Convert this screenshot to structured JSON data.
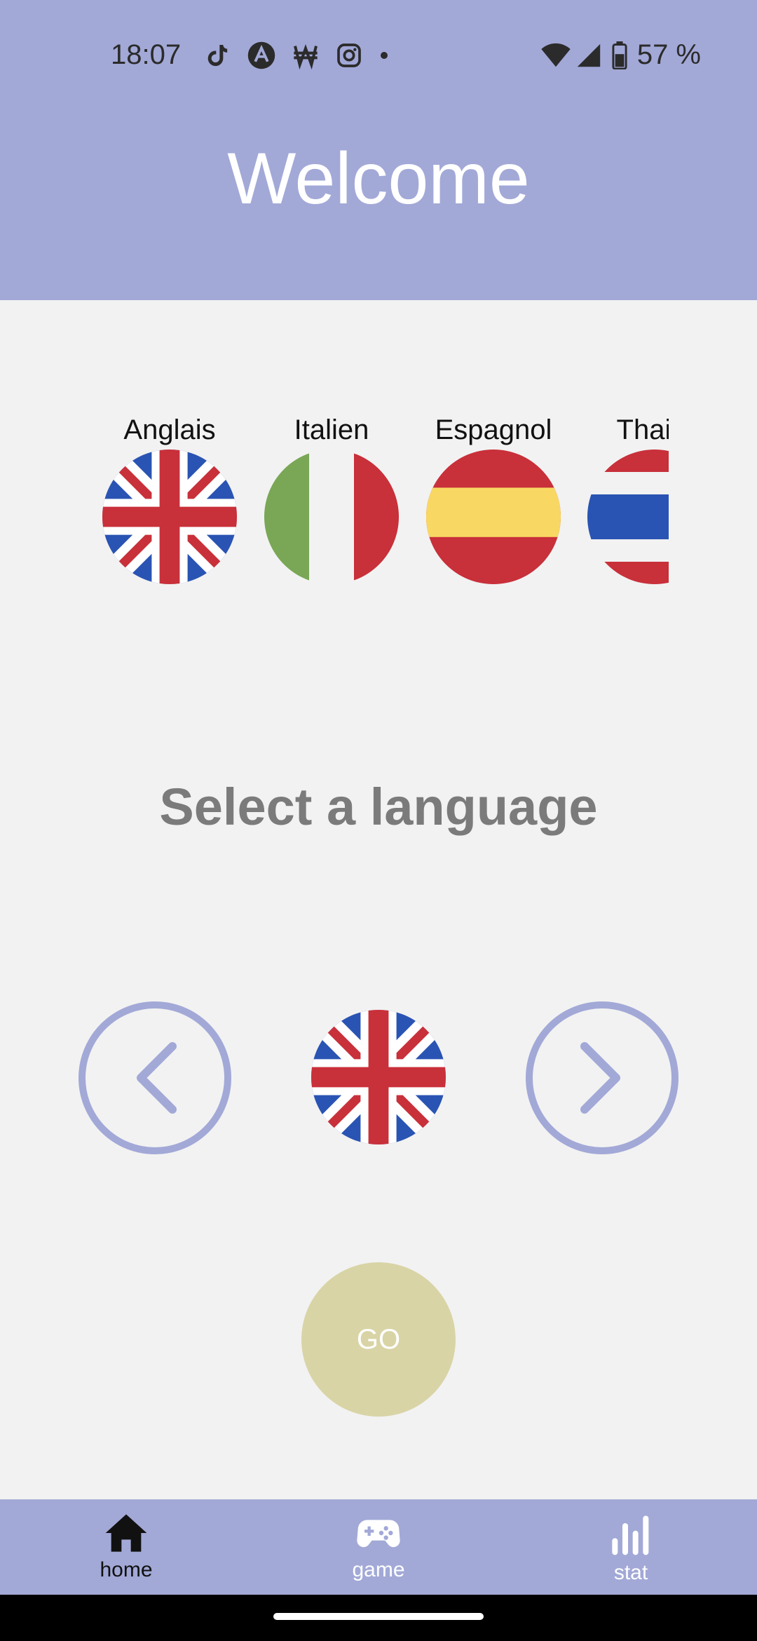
{
  "status_bar": {
    "time": "18:07",
    "battery": "57 %",
    "icons_left": [
      "tiktok-icon",
      "a-icon",
      "won-icon",
      "instagram-icon",
      "dot-icon"
    ],
    "icons_right": [
      "wifi-icon",
      "signal-icon",
      "battery-icon"
    ]
  },
  "header": {
    "title": "Welcome"
  },
  "languages": [
    {
      "label": "Anglais",
      "flag": "uk-flag-icon"
    },
    {
      "label": "Italien",
      "flag": "italy-flag-icon"
    },
    {
      "label": "Espagnol",
      "flag": "spain-flag-icon"
    },
    {
      "label": "Thaila",
      "flag": "thailand-flag-icon"
    }
  ],
  "selector": {
    "title": "Select a language",
    "selected_flag": "uk-flag-icon",
    "prev_icon": "chevron-left-icon",
    "next_icon": "chevron-right-icon"
  },
  "go_button": {
    "label": "GO"
  },
  "bottom_nav": {
    "items": [
      {
        "label": "home",
        "icon": "home-icon",
        "active": true
      },
      {
        "label": "game",
        "icon": "gamepad-icon",
        "active": false
      },
      {
        "label": "stat",
        "icon": "bar-chart-icon",
        "active": false
      }
    ]
  },
  "colors": {
    "accent": "#a2a9d7",
    "background": "#f2f2f2",
    "go_button": "#d9d4a6",
    "muted_text": "#7b7b7b"
  }
}
